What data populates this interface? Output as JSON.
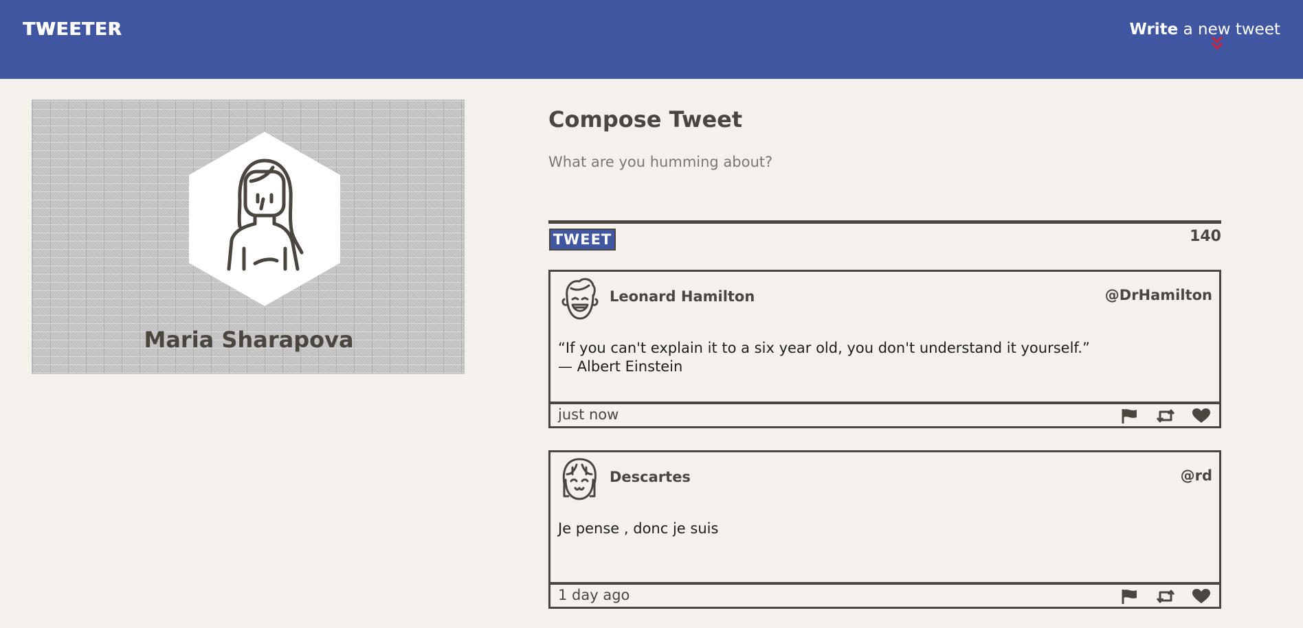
{
  "nav": {
    "brand": "TWEETER",
    "write_strong": "Write",
    "write_rest": " a new tweet",
    "icons": {
      "toggle": "double-chevron-down-icon"
    },
    "colors": {
      "background": "#4056a1",
      "toggle_icon": "#d11f3a"
    }
  },
  "profile": {
    "name": "Maria Sharapova",
    "avatar_icon": "woman-avatar-icon"
  },
  "compose": {
    "title": "Compose Tweet",
    "placeholder": "What are you humming about?",
    "button_label": "TWEET",
    "counter": "140"
  },
  "tweets": [
    {
      "author": "Leonard Hamilton",
      "handle": "@DrHamilton",
      "avatar_icon": "smiling-man-avatar-icon",
      "text_line1": "“If you can't explain it to a six year old, you don't understand it yourself.”",
      "text_line2": "— Albert Einstein",
      "timestamp": "just now",
      "actions": [
        "flag-icon",
        "retweet-icon",
        "heart-icon"
      ]
    },
    {
      "author": "Descartes",
      "handle": "@rd",
      "avatar_icon": "smiling-girl-avatar-icon",
      "text_line1": "Je pense , donc je suis",
      "text_line2": "",
      "timestamp": "1 day ago",
      "actions": [
        "flag-icon",
        "retweet-icon",
        "heart-icon"
      ]
    }
  ],
  "theme": {
    "page_background": "#f4f1ec",
    "text": "#4a463f",
    "accent": "#4056a1"
  }
}
